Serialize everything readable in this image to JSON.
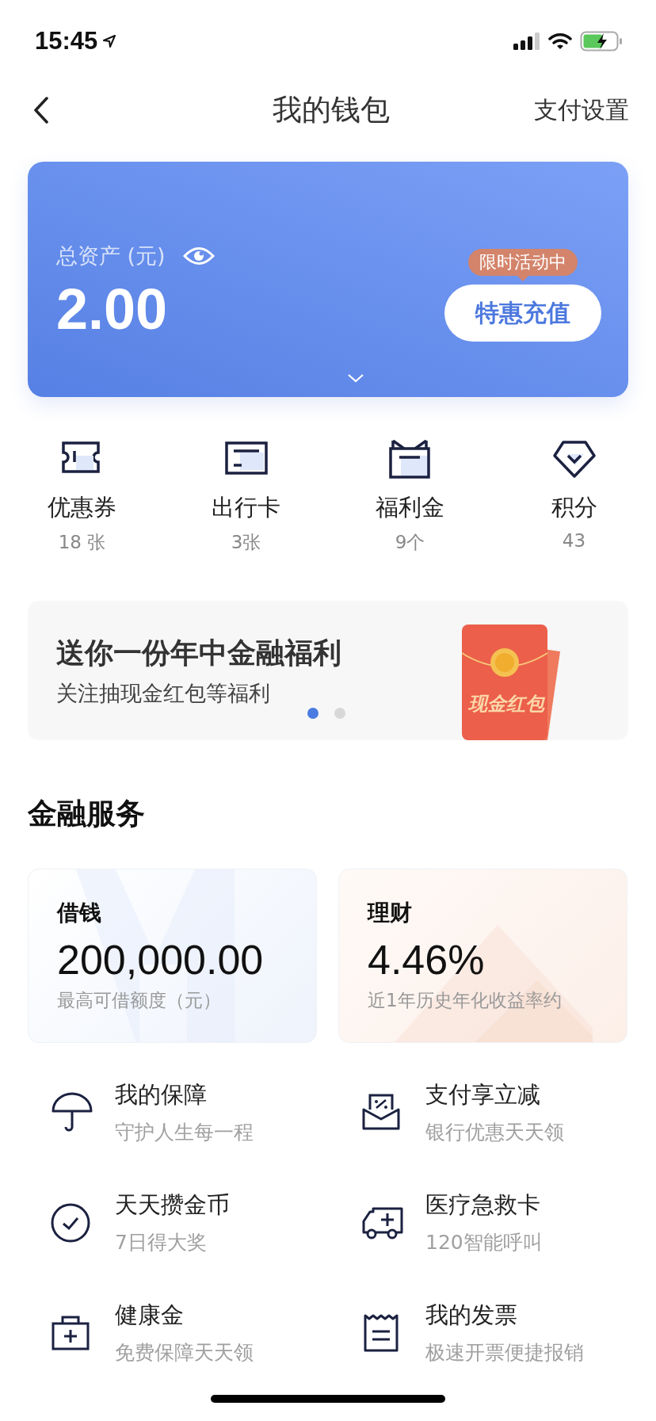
{
  "status_bar": {
    "time": "15:45"
  },
  "nav": {
    "title": "我的钱包",
    "action": "支付设置"
  },
  "balance_card": {
    "label": "总资产 (元)",
    "amount": "2.00",
    "badge": "限时活动中",
    "button": "特惠充值"
  },
  "shortcuts": [
    {
      "label": "优惠券",
      "count": "18 张"
    },
    {
      "label": "出行卡",
      "count": "3张"
    },
    {
      "label": "福利金",
      "count": "9个"
    },
    {
      "label": "积分",
      "count": "43"
    }
  ],
  "banner": {
    "title": "送你一份年中金融福利",
    "subtitle": "关注抽现金红包等福利",
    "art_label": "现金红包",
    "dots": [
      {
        "selected": true
      },
      {
        "selected": false
      }
    ]
  },
  "section_title": "金融服务",
  "finance_cards": [
    {
      "kind": "loan",
      "title": "借钱",
      "value": "200,000.00",
      "note": "最高可借额度（元）"
    },
    {
      "kind": "invest",
      "title": "理财",
      "value": "4.46%",
      "note": "近1年历史年化收益率约"
    }
  ],
  "services": [
    {
      "title": "我的保障",
      "subtitle": "守护人生每一程"
    },
    {
      "title": "支付享立减",
      "subtitle": "银行优惠天天领"
    },
    {
      "title": "天天攒金币",
      "subtitle": "7日得大奖"
    },
    {
      "title": "医疗急救卡",
      "subtitle": "120智能呼叫"
    },
    {
      "title": "健康金",
      "subtitle": "免费保障天天领"
    },
    {
      "title": "我的发票",
      "subtitle": "极速开票便捷报销"
    }
  ]
}
